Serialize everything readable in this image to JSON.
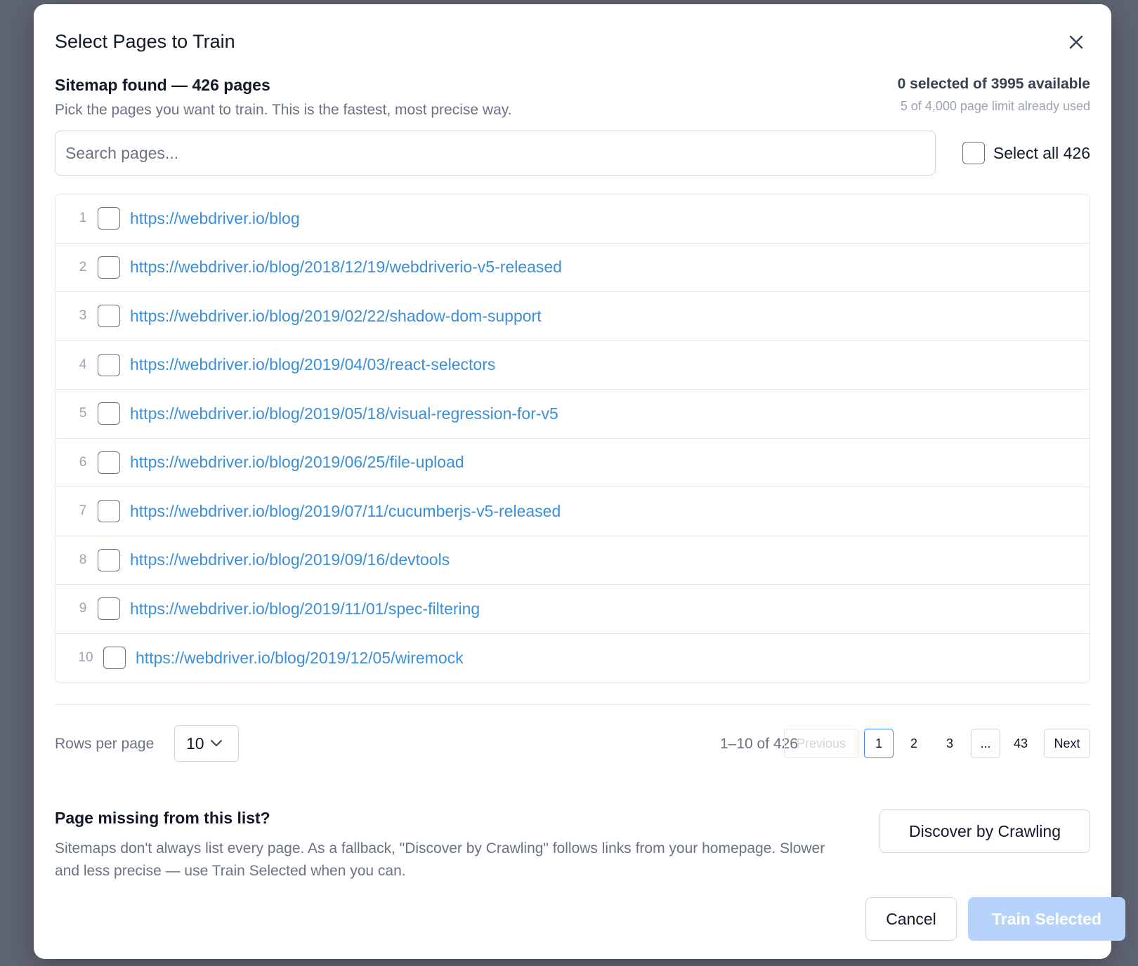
{
  "modal": {
    "title": "Select Pages to Train",
    "close_icon": "close-icon"
  },
  "summary": {
    "heading": "Sitemap found — 426 pages",
    "description": "Pick the pages you want to train. This is the fastest, most precise way.",
    "selected_text": "0 selected of 3995 available",
    "limit_text": "5 of 4,000 page limit already used"
  },
  "search": {
    "placeholder": "Search pages...",
    "value": ""
  },
  "select_all": {
    "label": "Select all 426",
    "checked": false
  },
  "pages": [
    {
      "num": "1",
      "url": "https://webdriver.io/blog"
    },
    {
      "num": "2",
      "url": "https://webdriver.io/blog/2018/12/19/webdriverio-v5-released"
    },
    {
      "num": "3",
      "url": "https://webdriver.io/blog/2019/02/22/shadow-dom-support"
    },
    {
      "num": "4",
      "url": "https://webdriver.io/blog/2019/04/03/react-selectors"
    },
    {
      "num": "5",
      "url": "https://webdriver.io/blog/2019/05/18/visual-regression-for-v5"
    },
    {
      "num": "6",
      "url": "https://webdriver.io/blog/2019/06/25/file-upload"
    },
    {
      "num": "7",
      "url": "https://webdriver.io/blog/2019/07/11/cucumberjs-v5-released"
    },
    {
      "num": "8",
      "url": "https://webdriver.io/blog/2019/09/16/devtools"
    },
    {
      "num": "9",
      "url": "https://webdriver.io/blog/2019/11/01/spec-filtering"
    },
    {
      "num": "10",
      "url": "https://webdriver.io/blog/2019/12/05/wiremock"
    }
  ],
  "pagination": {
    "rows_per_page_label": "Rows per page",
    "rows_per_page_value": "10",
    "range_text": "1–10 of 426",
    "previous": "Previous",
    "pages": [
      "1",
      "2",
      "3"
    ],
    "ellipsis": "...",
    "last": "43",
    "next": "Next",
    "current": "1"
  },
  "fallback": {
    "heading": "Page missing from this list?",
    "description": "Sitemaps don't always list every page. As a fallback, \"Discover by Crawling\" follows links from your homepage. Slower and less precise — use Train Selected when you can.",
    "crawl_button": "Discover by Crawling"
  },
  "footer": {
    "cancel": "Cancel",
    "train": "Train Selected"
  },
  "colors": {
    "link": "#3b8fd9",
    "primary_disabled": "#b6d4fb",
    "active_page_border": "#3b82f6"
  }
}
